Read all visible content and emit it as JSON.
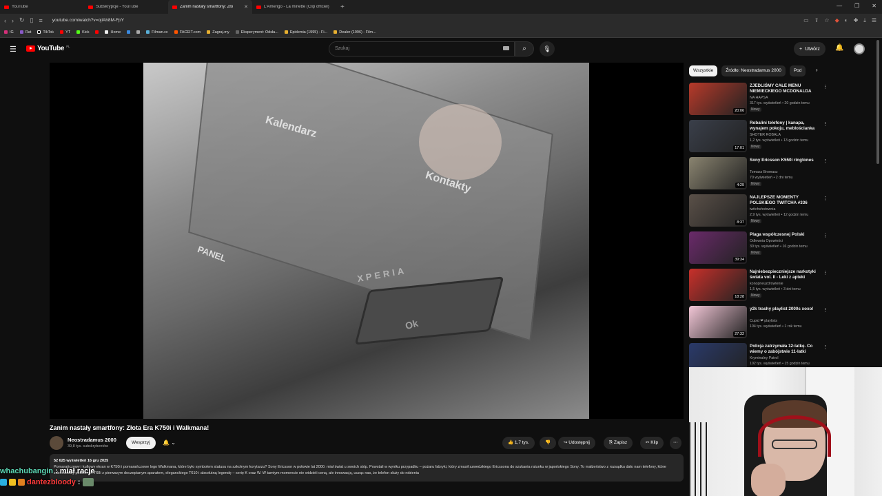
{
  "browser": {
    "tabs": [
      {
        "label": "YouTube",
        "active": false
      },
      {
        "label": "Subskrypcje - YouTube",
        "active": false
      },
      {
        "label": "Zanim nastały smartfony: Zło",
        "active": true
      },
      {
        "label": "L'Amerigo - La minette (Clip officiel)",
        "active": false
      }
    ],
    "url": "youtube.com/watch?v=ojlAh8M-FpY",
    "bookmarks": [
      "IG",
      "Rat",
      "TikTok",
      "YT",
      "Kick",
      "Home",
      "Filman.cc",
      "FACEIT.com",
      "Zagraj.my",
      "Eksperyment: Odsła...",
      "Epidemia (1995) - Fi...",
      "Dealer (1996) - Film..."
    ]
  },
  "header": {
    "logo": "YouTube",
    "logo_region": "PL",
    "search_placeholder": "Szukaj",
    "create_label": "Utwórz"
  },
  "video": {
    "title": "Zanim nastały smartfony: Złota Era K750i i Walkmana!",
    "overlay_text": {
      "calendar": "Kalendarz",
      "contacts": "Kontakty",
      "panel": "PANEL",
      "brand": "XPERIA",
      "ok": "Ok"
    },
    "channel": {
      "name": "Neostradamus 2000",
      "subs": "39,8 tys. subskrybentów",
      "support_label": "Wesprzyj"
    },
    "actions": {
      "likes": "1,7 tys.",
      "share": "Udostępnij",
      "save": "Zapisz",
      "clip": "Klip"
    },
    "description": {
      "views": "52 625 wyświetleń",
      "date": "16 gru 2025",
      "text": "Pomarańczowy i kultowy ekran w K750i i pomarańczowe logo Walkmana, które było symbolem statusu na szkolnym korytarzu? Sony Ericsson w połowie lat 2000. miał świat u swoich stóp. Powstali w wyniku przypadku – pożaru fabryki, który zmusił szwedzkiego Ericssona do szukania ratunku w japońskiego Sony. To małżeństwo z rozsądku dało nam telefony, które zdefiniowały pokolenie: T68i z pierwszym doczepianym aparatem, eleganckiego T610 i absolutną legendę – serię K oraz W. W tamtym momencie nie widzieli ceną, ale innowacją, ucząc nas, że telefon służy do robienia"
    }
  },
  "sidebar": {
    "chips": [
      "Wszystkie",
      "Źródło: Neostradamus 2000",
      "Pod"
    ],
    "recommendations": [
      {
        "title": "ZJEDLIŚMY CAŁE MENU NIEMIECKIEGO MCDONALDA",
        "channel": "NA HAPSA",
        "meta": "317 tys. wyświetleń • 20 godzin temu",
        "badge": "Nowy",
        "duration": "20:06",
        "thumb_color": "#b83a2a"
      },
      {
        "title": "Robalini telefony | kanapa, wynajem pokoju, meblościanka",
        "channel": "SHOTER ROBALA",
        "meta": "1,2 tys. wyświetleń • 13 godzin temu",
        "badge": "Nowy",
        "duration": "17:01",
        "thumb_color": "#3a3f4a"
      },
      {
        "title": "Sony Ericsson K550i ringtones",
        "channel": "Tomasz Bromasz",
        "meta": "70 wyświetleń • 2 dni temu",
        "badge": "Nowy",
        "duration": "4:29",
        "thumb_color": "#8a8470"
      },
      {
        "title": "NAJLEPSZE MOMENTY POLSKIEGO TWITCHA #336",
        "channel": "twitchshotownia",
        "meta": "2,9 tys. wyświetleń • 12 godzin temu",
        "badge": "Nowy",
        "duration": "8:37",
        "thumb_color": "#5a5048"
      },
      {
        "title": "Plaga współczesnej Polski",
        "channel": "Odlewnia Opowieści",
        "meta": "30 tys. wyświetleń • 16 godzin temu",
        "badge": "Nowy",
        "duration": "39:34",
        "thumb_color": "#6a2a6a"
      },
      {
        "title": "Najniebezpieczniejsze narkotyki świata vol. II - Leki z apteki",
        "channel": "konopneuzdrowienie",
        "meta": "1,5 tys. wyświetleń • 3 dni temu",
        "badge": "Nowy",
        "duration": "18:28",
        "thumb_color": "#c8302a"
      },
      {
        "title": "y2k trashy playlist 2000s xoxo!",
        "channel": "Cupid ❤ playlists",
        "meta": "104 tys. wyświetleń • 1 rok temu",
        "badge": "",
        "duration": "27:32",
        "thumb_color": "#f2c6d6"
      },
      {
        "title": "Policja zatrzymała 12-latkę. Co wiemy o zabójstwie 11-latki",
        "channel": "Kryminalny Patrol",
        "meta": "102 tys. wyświetleń • 15 godzin temu",
        "badge": "",
        "duration": "20:41",
        "thumb_color": "#2a3a6a"
      }
    ]
  },
  "chat": {
    "line1_user": "whachubangin",
    "line1_msg": ": miał racje",
    "line2_user": "dantezbloody",
    "line2_msg": ":"
  }
}
